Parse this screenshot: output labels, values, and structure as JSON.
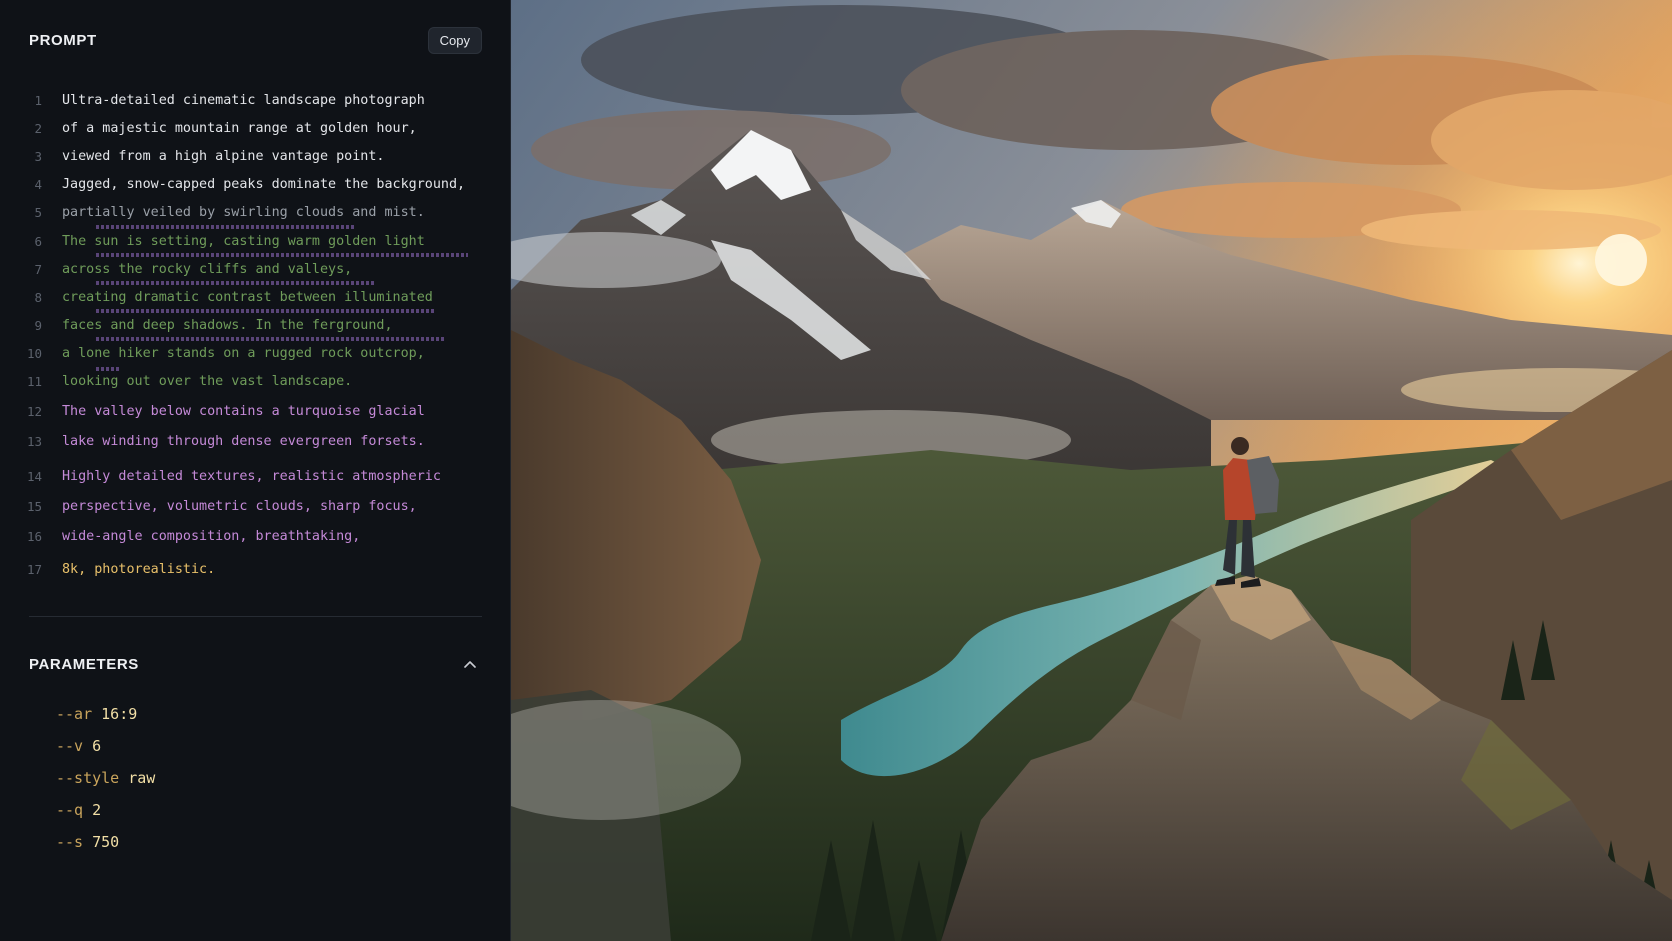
{
  "prompt_panel": {
    "title": "PROMPT",
    "copy_label": "Copy",
    "lines": [
      {
        "n": "1",
        "text": "Ultra-detailed cinematic landscape photograph",
        "color": "#e3e5e9"
      },
      {
        "n": "2",
        "text": "of a majestic mountain range at golden hour,",
        "color": "#e3e5e9"
      },
      {
        "n": "3",
        "text": "viewed from a high alpine vantage point.",
        "color": "#e3e5e9"
      },
      {
        "n": "4",
        "text": "Jagged, snow-capped peaks dominate the background,",
        "color": "#e3e5e9"
      },
      {
        "n": "5",
        "text": "partially veiled by swirling clouds and mist.",
        "color": "#9aa0a8"
      },
      {
        "n": "6",
        "text": "The sun is setting, casting warm golden light",
        "color": "#6f9c5a"
      },
      {
        "n": "7",
        "text": "across the rocky cliffs and valleys,",
        "color": "#6f9c5a"
      },
      {
        "n": "8",
        "text": "creating dramatic contrast between illuminated",
        "color": "#6f9c5a"
      },
      {
        "n": "9",
        "text": "faces and deep shadows. In the ferground,",
        "color": "#6f9c5a"
      },
      {
        "n": "10",
        "text": "a lone hiker stands on a rugged rock outcrop,",
        "color": "#6f9c5a"
      },
      {
        "n": "11",
        "text": "looking out over the vast landscape.",
        "color": "#6f9c5a"
      },
      {
        "n": "12",
        "text": "The valley below contains a turquoise glacial",
        "color": "#c58ad8"
      },
      {
        "n": "13",
        "text": "lake winding through dense evergreen forsets.",
        "color": "#c58ad8"
      },
      {
        "n": "14",
        "text": "Highly detailed textures, realistic atmospheric",
        "color": "#c58ad8"
      },
      {
        "n": "15",
        "text": "perspective, volumetric clouds, sharp focus,",
        "color": "#c58ad8"
      },
      {
        "n": "16",
        "text": "wide-angle composition, breathtaking,",
        "color": "#c58ad8"
      },
      {
        "n": "17",
        "text": "8k, photorealistic.",
        "color": "#e8c06a"
      }
    ]
  },
  "parameters": {
    "title": "PARAMETERS",
    "items": [
      {
        "flag": "--ar",
        "value": "16:9"
      },
      {
        "flag": "--v",
        "value": "6"
      },
      {
        "flag": "--style",
        "value": "raw"
      },
      {
        "flag": "--q",
        "value": "2"
      },
      {
        "flag": "--s",
        "value": "750"
      }
    ]
  },
  "image": {
    "subject": "mountain-landscape-with-hiker"
  }
}
